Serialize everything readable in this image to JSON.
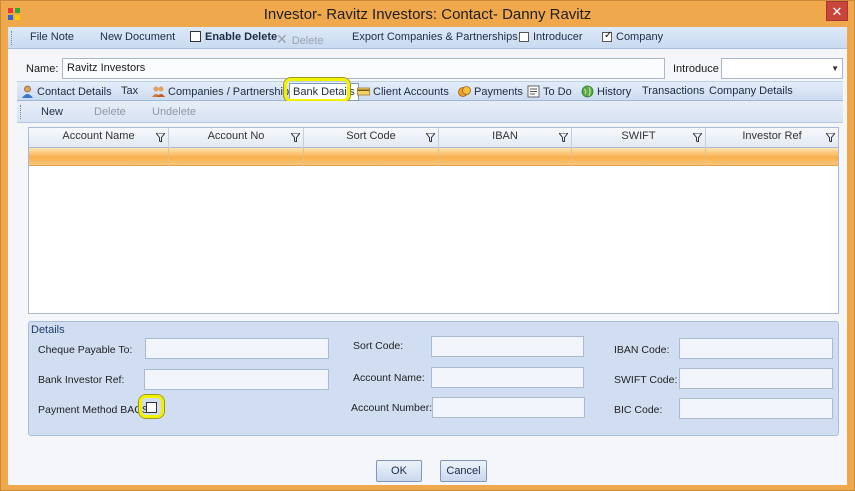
{
  "window": {
    "title": "Investor- Ravitz Investors: Contact- Danny Ravitz",
    "close_glyph": "✕"
  },
  "toolbar": {
    "file_note": "File Note",
    "new_document": "New Document",
    "enable_delete": {
      "label": "Enable Delete",
      "checked": false
    },
    "delete": "Delete",
    "delete_glyph": "✕",
    "export": "Export Companies & Partnerships",
    "introducer": {
      "label": "Introducer",
      "checked": false
    },
    "company": {
      "label": "Company",
      "checked": true,
      "check_glyph": "✓"
    }
  },
  "name_row": {
    "name_label": "Name:",
    "name_value": "Ravitz Investors",
    "introduce_label": "Introduce",
    "introduce_value": "",
    "dropdown_glyph": "▼"
  },
  "tabs": [
    {
      "label": "Contact Details",
      "icon": "person-icon"
    },
    {
      "label": "Tax",
      "icon": ""
    },
    {
      "label": "Companies / Partnerships",
      "icon": "people-icon"
    },
    {
      "label": "Bank Details",
      "icon": "",
      "active": true
    },
    {
      "label": "Client Accounts",
      "icon": "card-icon"
    },
    {
      "label": "Payments",
      "icon": "coins-icon"
    },
    {
      "label": "To Do",
      "icon": "todo-icon"
    },
    {
      "label": "History",
      "icon": "globe-icon"
    },
    {
      "label": "Transactions",
      "icon": ""
    },
    {
      "label": "Company Details",
      "icon": ""
    }
  ],
  "subtoolbar": {
    "new": "New",
    "delete": "Delete",
    "undelete": "Undelete"
  },
  "grid": {
    "columns": [
      "Account Name",
      "Account No",
      "Sort Code",
      "IBAN",
      "SWIFT",
      "Investor Ref"
    ],
    "rows": [
      [
        "",
        "",
        "",
        "",
        "",
        ""
      ]
    ]
  },
  "details": {
    "title": "Details",
    "cheque_payable_to": {
      "label": "Cheque Payable To:",
      "value": ""
    },
    "bank_investor_ref": {
      "label": "Bank Investor Ref:",
      "value": ""
    },
    "payment_method_bacs": {
      "label": "Payment Method BACS:",
      "checked": false
    },
    "sort_code": {
      "label": "Sort Code:",
      "value": ""
    },
    "account_name": {
      "label": "Account Name:",
      "value": ""
    },
    "account_number": {
      "label": "Account Number:",
      "value": ""
    },
    "iban_code": {
      "label": "IBAN Code:",
      "value": ""
    },
    "swift_code": {
      "label": "SWIFT Code:",
      "value": ""
    },
    "bic_code": {
      "label": "BIC Code:",
      "value": ""
    }
  },
  "buttons": {
    "ok": "OK",
    "cancel": "Cancel"
  },
  "colors": {
    "window_border": "#f0a84c",
    "selected_row": "#f8b04c",
    "highlight_ring": "#f2f200",
    "close_button": "#c9453c"
  }
}
